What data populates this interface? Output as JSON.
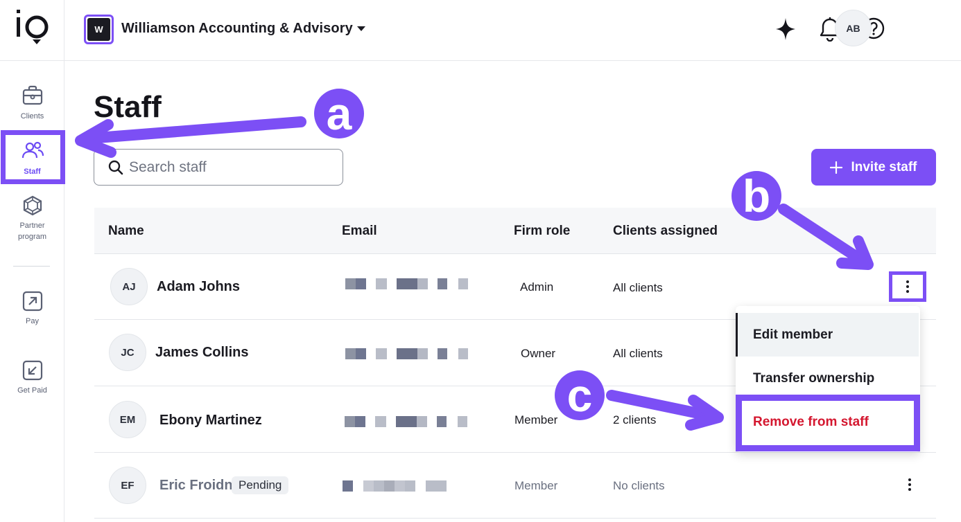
{
  "sidebar": {
    "items": [
      {
        "label": "Clients",
        "icon": "briefcase-icon"
      },
      {
        "label": "Staff",
        "icon": "people-icon"
      },
      {
        "label": "Partner program",
        "icon": "hexagon-gem-icon"
      },
      {
        "label": "Pay",
        "icon": "arrow-up-right-box-icon"
      },
      {
        "label": "Get Paid",
        "icon": "arrow-down-left-box-icon"
      }
    ]
  },
  "header": {
    "firm_initial": "W",
    "firm_name": "Williamson Accounting & Advisory",
    "user_initials": "AB"
  },
  "page": {
    "title": "Staff",
    "search_placeholder": "Search staff",
    "invite_label": "Invite staff"
  },
  "table": {
    "columns": [
      "Name",
      "Email",
      "Firm role",
      "Clients assigned"
    ],
    "rows": [
      {
        "initials": "AJ",
        "name": "Adam Johns",
        "role": "Admin",
        "clients": "All clients",
        "pending": ""
      },
      {
        "initials": "JC",
        "name": "James Collins",
        "role": "Owner",
        "clients": "All clients",
        "pending": ""
      },
      {
        "initials": "EM",
        "name": "Ebony Martinez",
        "role": "Member",
        "clients": "2 clients",
        "pending": ""
      },
      {
        "initials": "EF",
        "name": "Eric Froidn",
        "role": "Member",
        "clients": "No clients",
        "pending": "Pending"
      }
    ]
  },
  "menu": {
    "items": [
      "Edit member",
      "Transfer ownership",
      "Remove from staff"
    ]
  },
  "annotations": [
    "a",
    "b",
    "c"
  ],
  "colors": {
    "accent": "#7c4ff5",
    "danger": "#d4172f",
    "text": "#1b1b22"
  }
}
